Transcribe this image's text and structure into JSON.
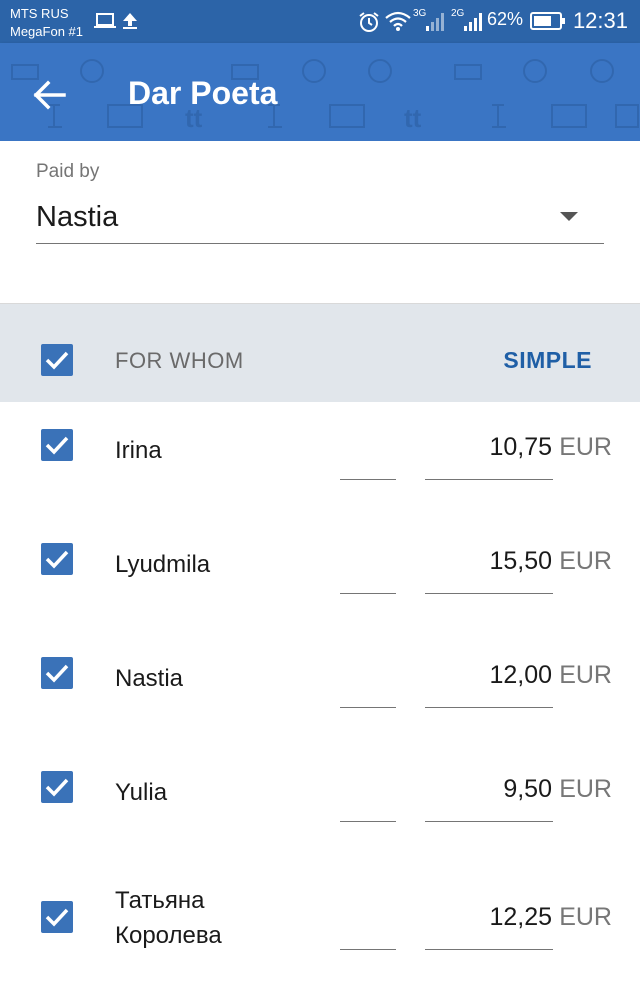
{
  "status_bar": {
    "carrier_line1": "MTS RUS",
    "carrier_line2": "MegaFon #1",
    "network_1": "3G",
    "network_2": "2G",
    "battery": "62%",
    "time": "12:31"
  },
  "app_bar": {
    "title": "Dar Poeta",
    "back_icon": "arrow-left-icon"
  },
  "paid_by": {
    "label": "Paid by",
    "value": "Nastia"
  },
  "for_whom": {
    "label": "FOR WHOM",
    "all_checked": true,
    "mode_button": "SIMPLE"
  },
  "participants": [
    {
      "name": "Irina",
      "amount": "10,75",
      "currency": "EUR",
      "checked": true
    },
    {
      "name": "Lyudmila",
      "amount": "15,50",
      "currency": "EUR",
      "checked": true
    },
    {
      "name": "Nastia",
      "amount": "12,00",
      "currency": "EUR",
      "checked": true
    },
    {
      "name": "Yulia",
      "amount": "9,50",
      "currency": "EUR",
      "checked": true
    },
    {
      "name": "Татьяна\nКоролева",
      "amount": "12,25",
      "currency": "EUR",
      "checked": true
    }
  ],
  "colors": {
    "status_bar": "#2c64a8",
    "app_bar": "#3a75c4",
    "checkbox": "#3a72b8",
    "accent_text": "#1f5fa6",
    "header_bg": "#e1e6eb"
  }
}
